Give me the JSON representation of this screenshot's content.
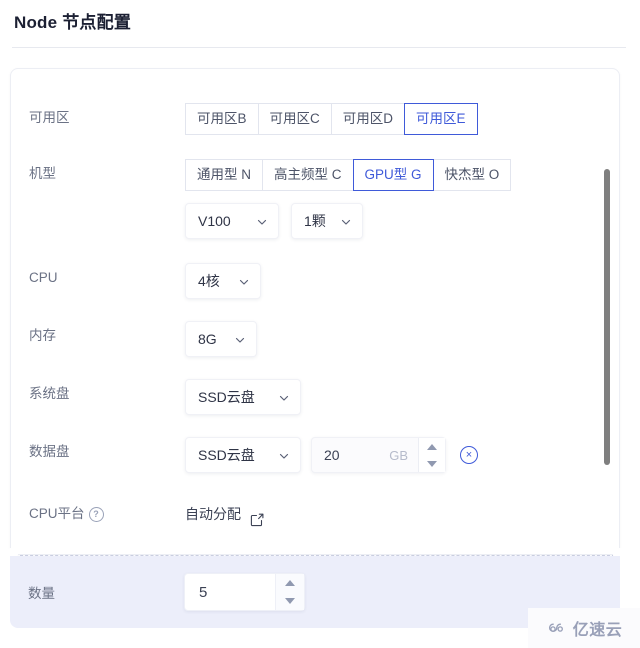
{
  "header": {
    "title": "Node 节点配置"
  },
  "form": {
    "zone": {
      "label": "可用区",
      "options": [
        "可用区B",
        "可用区C",
        "可用区D",
        "可用区E"
      ],
      "selected": "可用区E"
    },
    "machine_type": {
      "label": "机型",
      "options": [
        "通用型 N",
        "高主频型 C",
        "GPU型 G",
        "快杰型 O"
      ],
      "selected": "GPU型 G"
    },
    "gpu": {
      "model_value": "V100",
      "count_value": "1颗"
    },
    "cpu": {
      "label": "CPU",
      "value": "4核"
    },
    "memory": {
      "label": "内存",
      "value": "8G"
    },
    "system_disk": {
      "label": "系统盘",
      "value": "SSD云盘"
    },
    "data_disk": {
      "label": "数据盘",
      "type_value": "SSD云盘",
      "size_value": "20",
      "size_unit": "GB",
      "remove_label": "×"
    },
    "cpu_platform": {
      "label": "CPU平台",
      "help_icon": "help-circle-icon",
      "help_glyph": "?",
      "value": "自动分配",
      "edit_icon": "edit-box-icon"
    }
  },
  "quantity": {
    "label": "数量",
    "value": "5"
  },
  "watermark": {
    "text": "亿速云",
    "logo_icon": "cloud-logo-icon"
  },
  "colors": {
    "accent": "#3f5ad9",
    "label_text": "#6b7285",
    "value_text": "#3b4154",
    "qty_section_bg": "#eceefa",
    "card_border": "#eceef4"
  }
}
